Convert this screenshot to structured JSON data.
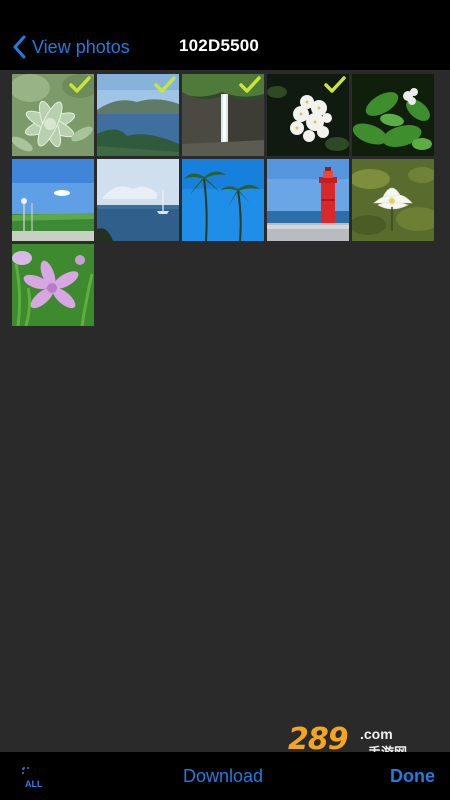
{
  "navbar": {
    "back_label": "View photos",
    "title": "102D5500"
  },
  "photos": [
    {
      "subject": "succulent",
      "selected": true
    },
    {
      "subject": "bay-coastline",
      "selected": true
    },
    {
      "subject": "waterfall-cliff",
      "selected": true
    },
    {
      "subject": "white-flower-cluster",
      "selected": true
    },
    {
      "subject": "green-leaves-white-blossom",
      "selected": false
    },
    {
      "subject": "seaside-grass",
      "selected": false
    },
    {
      "subject": "sea-with-sailboat",
      "selected": false
    },
    {
      "subject": "palm-trees",
      "selected": false
    },
    {
      "subject": "red-lighthouse",
      "selected": false
    },
    {
      "subject": "water-lily",
      "selected": false
    },
    {
      "subject": "pink-lily-flower",
      "selected": false
    }
  ],
  "toolbar": {
    "all_label": "ALL",
    "download_label": "Download",
    "done_label": "Done"
  },
  "watermark": {
    "main": "289",
    "suffix": ".com",
    "cn": "手游网"
  },
  "colors": {
    "accent": "#1f7ce0",
    "check": "#c8e63a",
    "background": "#2a2a2a",
    "bar": "#000000"
  }
}
